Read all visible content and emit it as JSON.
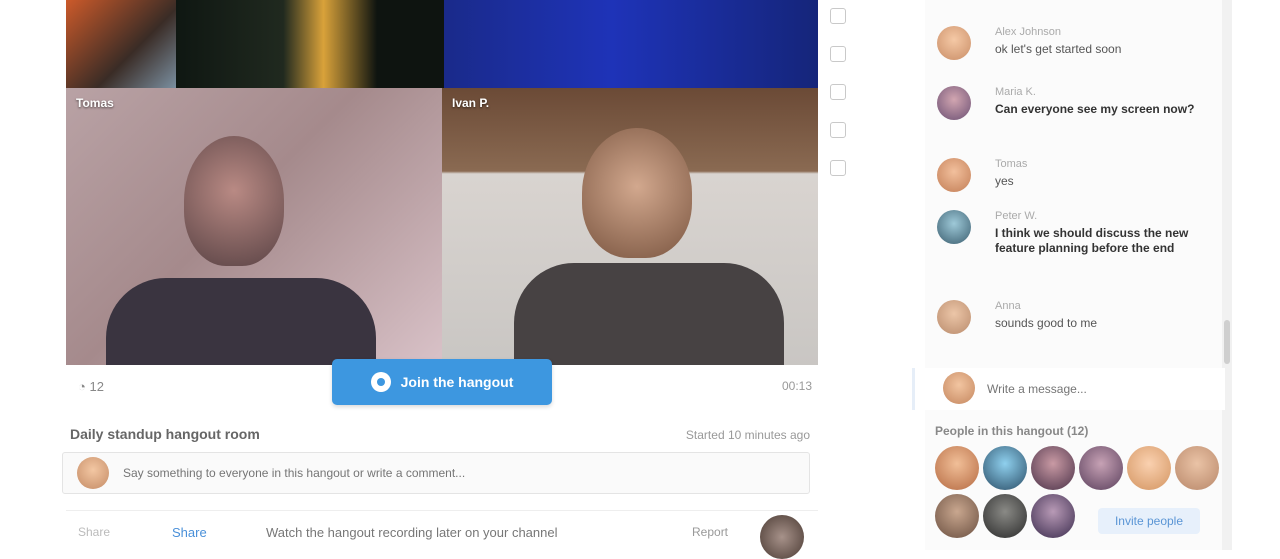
{
  "video": {
    "tiles": [
      {
        "name": ""
      },
      {
        "name": ""
      },
      {
        "name": ""
      },
      {
        "name": "Tomas"
      },
      {
        "name": "Ivan P."
      }
    ],
    "join_label": "Join the hangout",
    "participants_count": "12",
    "timer": "00:13"
  },
  "room": {
    "title": "Daily standup hangout room",
    "meta": "Started 10 minutes ago",
    "comment_placeholder": "Say something to everyone in this hangout or write a comment..."
  },
  "footer": {
    "item1": "Share",
    "item2": "Share",
    "item3": "Watch the hangout recording later on your channel",
    "item4": "Report"
  },
  "chat": {
    "messages": [
      {
        "who": "Alex Johnson",
        "text": "ok let's get started soon"
      },
      {
        "who": "Maria K.",
        "text": "Can everyone see my screen now?"
      },
      {
        "who": "Tomas",
        "text": "yes"
      },
      {
        "who": "Peter W.",
        "text": "I think we should discuss the new feature planning before the end"
      },
      {
        "who": "Anna",
        "text": "sounds good to me"
      }
    ],
    "input_placeholder": "Write a message...",
    "people_title": "People in this hangout (12)",
    "invite_label": "Invite people"
  },
  "colors": {
    "accent": "#3d97e0",
    "chat_bg": "#fbfbfb"
  }
}
